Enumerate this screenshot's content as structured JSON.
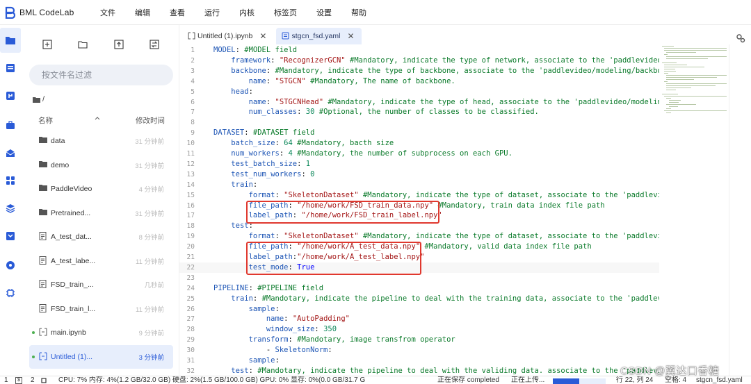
{
  "app": {
    "title": "BML CodeLab",
    "accent": "#2a5bd7"
  },
  "menu": [
    "文件",
    "编辑",
    "查看",
    "运行",
    "内核",
    "标签页",
    "设置",
    "帮助"
  ],
  "rail_icons": [
    "folder-icon",
    "running-icon",
    "git-icon",
    "toolbox-icon",
    "dataset-icon",
    "extension-icon",
    "layers-icon",
    "download-icon",
    "settings-icon",
    "chip-icon"
  ],
  "file_panel": {
    "search_placeholder": "按文件名过滤",
    "path": "/",
    "col_name": "名称",
    "col_time": "修改时间",
    "files": [
      {
        "name": "data",
        "time": "31 分钟前",
        "type": "folder",
        "running": false,
        "selected": false
      },
      {
        "name": "demo",
        "time": "31 分钟前",
        "type": "folder",
        "running": false,
        "selected": false
      },
      {
        "name": "PaddleVideo",
        "time": "4 分钟前",
        "type": "folder",
        "running": false,
        "selected": false
      },
      {
        "name": "Pretrained...",
        "time": "31 分钟前",
        "type": "folder",
        "running": false,
        "selected": false
      },
      {
        "name": "A_test_dat...",
        "time": "8 分钟前",
        "type": "file",
        "running": false,
        "selected": false
      },
      {
        "name": "A_test_labe...",
        "time": "11 分钟前",
        "type": "file",
        "running": false,
        "selected": false
      },
      {
        "name": "FSD_train_...",
        "time": "几秒前",
        "type": "file",
        "running": false,
        "selected": false
      },
      {
        "name": "FSD_train_l...",
        "time": "11 分钟前",
        "type": "file",
        "running": false,
        "selected": false
      },
      {
        "name": "main.ipynb",
        "time": "9 分钟前",
        "type": "notebook",
        "running": true,
        "selected": false
      },
      {
        "name": "Untitled (1)...",
        "time": "3 分钟前",
        "type": "notebook",
        "running": true,
        "selected": true
      }
    ]
  },
  "tabs": [
    {
      "label": "Untitled (1).ipynb",
      "active": false
    },
    {
      "label": "stgcn_fsd.yaml",
      "active": true
    }
  ],
  "editor": {
    "current_line": 22,
    "highlighted_ranges": [
      [
        16,
        17
      ],
      [
        20,
        22
      ]
    ],
    "lines": [
      "MODEL: #MODEL field",
      "    framework: \"RecognizerGCN\" #Mandatory, indicate the type of network, associate to the 'paddlevideo/mo",
      "    backbone: #Mandatory, indicate the type of backbone, associate to the 'paddlevideo/modeling/backbones",
      "        name: \"STGCN\" #Mandatory, The name of backbone.",
      "    head:",
      "        name: \"STGCNHead\" #Mandatory, indicate the type of head, associate to the 'paddlevideo/modeling/",
      "        num_classes: 30 #Optional, the number of classes to be classified.",
      "",
      "DATASET: #DATASET field",
      "    batch_size: 64 #Mandatory, bacth size",
      "    num_workers: 4 #Mandatory, the number of subprocess on each GPU.",
      "    test_batch_size: 1",
      "    test_num_workers: 0",
      "    train:",
      "        format: \"SkeletonDataset\" #Mandatory, indicate the type of dataset, associate to the 'paddlevide",
      "        file_path: \"/home/work/FSD_train_data.npy\" #Mandatory, train data index file path",
      "        label_path: \"/home/work/FSD_train_label.npy\"",
      "    test:",
      "        format: \"SkeletonDataset\" #Mandatory, indicate the type of dataset, associate to the 'paddlevide",
      "        file_path: \"/home/work/A_test_data.npy\" #Mandatory, valid data index file path",
      "        label_path:\"/home/work/A_test_label.npy\"",
      "        test_mode: True",
      "",
      "PIPELINE: #PIPELINE field",
      "    train: #Mandotary, indicate the pipeline to deal with the training data, associate to the 'paddlevide",
      "        sample:",
      "            name: \"AutoPadding\"",
      "            window_size: 350",
      "        transform: #Mandotary, image transfrom operator",
      "            - SkeletonNorm:",
      "        sample:",
      "    test: #Mandotary, indicate the pipeline to deal with the validing data. associate to the 'paddlevide",
      "        sample:"
    ]
  },
  "status": {
    "kernels": "1",
    "terminals": "2",
    "resources": "CPU: 7% 内存: 4%(1.2 GB/32.0 GB) 硬盘: 2%(1.5 GB/100.0 GB) GPU: 0% 显存: 0%(0.0 GB/31.7 G",
    "save_state": "正在保存 completed",
    "upload_state": "正在上传...",
    "upload_progress": 0.5,
    "cursor": "行 22, 列 24",
    "indent": "空格: 4",
    "filename": "stgcn_fsd.yaml"
  },
  "watermark": "CSDN @翼达口香糖"
}
